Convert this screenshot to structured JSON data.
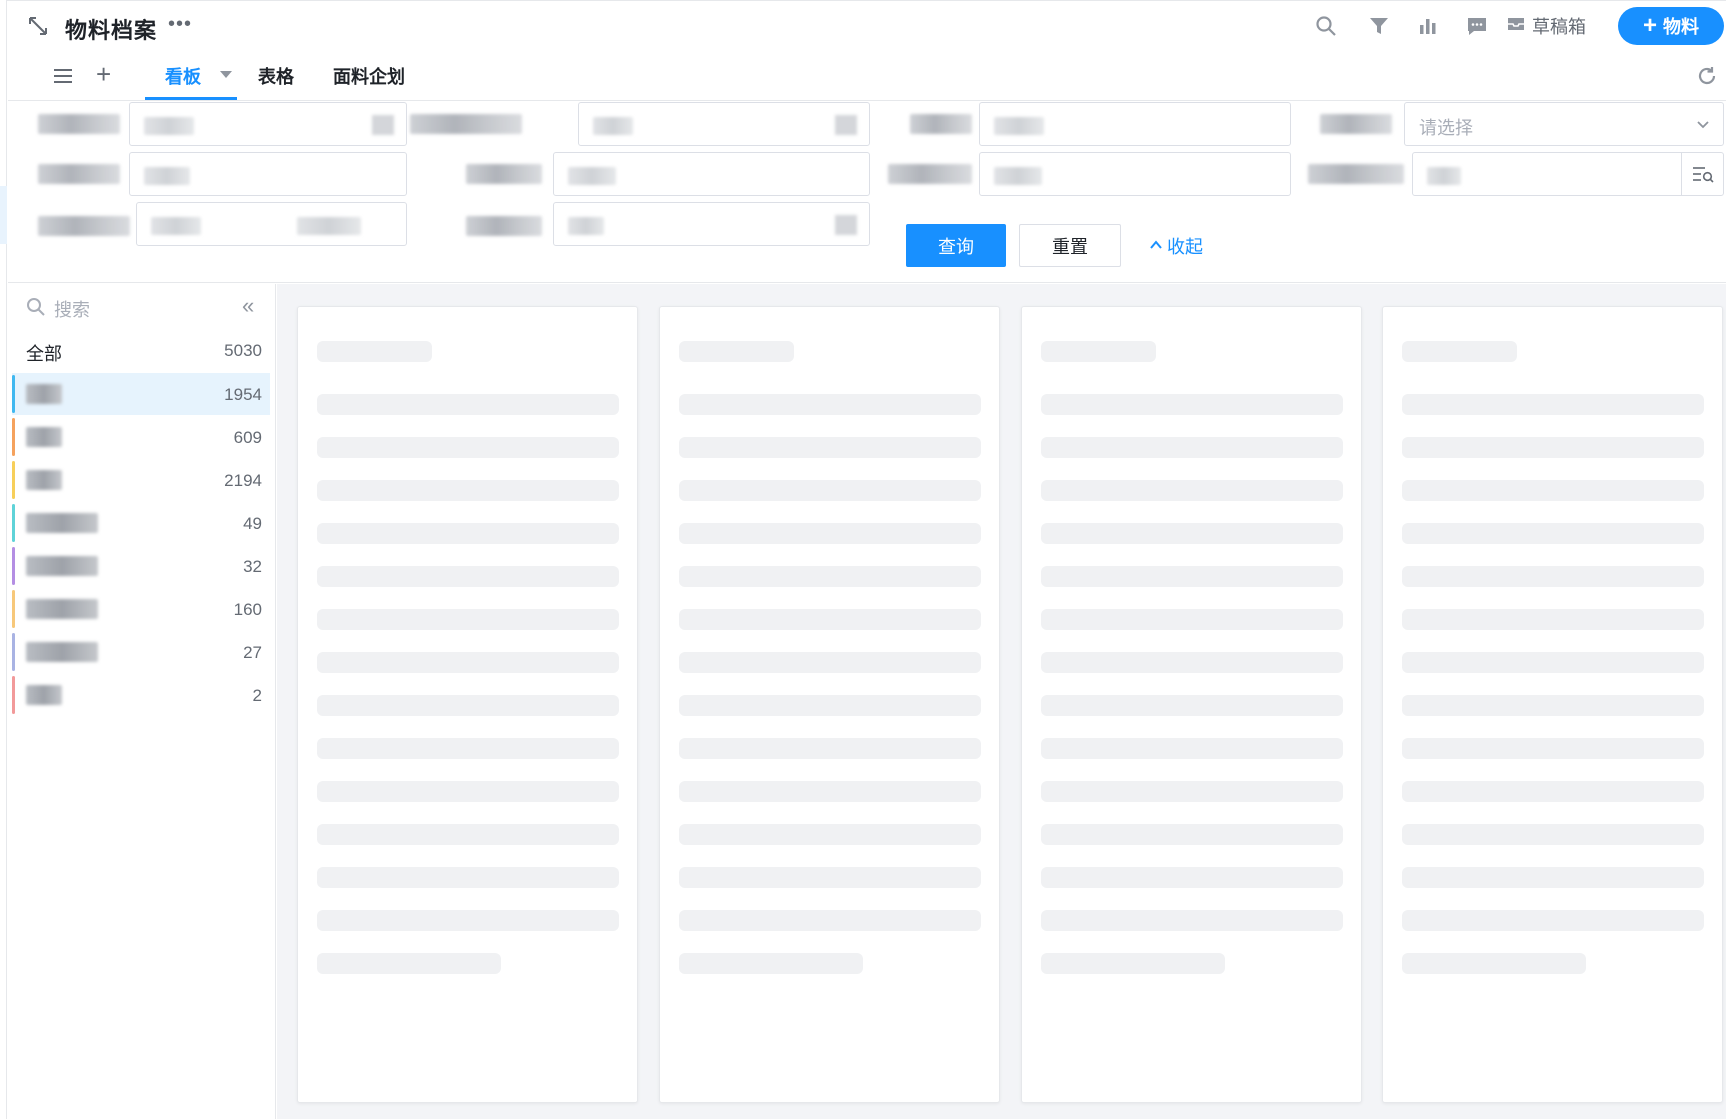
{
  "header": {
    "title": "物料档案",
    "more": "•••",
    "draft_label": "草稿箱",
    "add_label": "物料",
    "icons": [
      "expand-icon",
      "search-icon",
      "filter-icon",
      "chart-icon",
      "comment-icon",
      "inbox-icon",
      "plus-icon"
    ]
  },
  "tabs": [
    {
      "label": "看板",
      "active": true
    },
    {
      "label": "表格",
      "active": false
    },
    {
      "label": "面料企划",
      "active": false
    }
  ],
  "filter": {
    "select_placeholder": "请选择",
    "query_label": "查询",
    "reset_label": "重置",
    "collapse_label": "收起"
  },
  "sidebar": {
    "search_placeholder": "搜索",
    "items": [
      {
        "name": "全部",
        "count": "5030"
      },
      {
        "name": "",
        "count": "1954",
        "color": "#40b8f0"
      },
      {
        "name": "",
        "count": "609",
        "color": "#f5a25d"
      },
      {
        "name": "",
        "count": "2194",
        "color": "#f7cf5a"
      },
      {
        "name": "",
        "count": "49",
        "color": "#5fd3d8"
      },
      {
        "name": "",
        "count": "32",
        "color": "#b48ee3"
      },
      {
        "name": "",
        "count": "160",
        "color": "#f7c87a"
      },
      {
        "name": "",
        "count": "27",
        "color": "#a9b3e3"
      },
      {
        "name": "",
        "count": "2",
        "color": "#f29a9a"
      }
    ]
  },
  "colors": {
    "accent": "#1890ff",
    "board_bg": "#f3f4f7",
    "skeleton": "#f0f1f3"
  }
}
